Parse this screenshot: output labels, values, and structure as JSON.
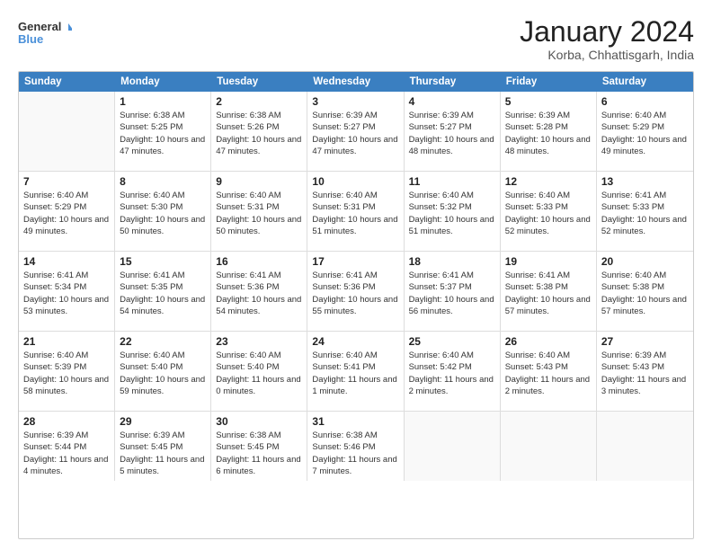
{
  "header": {
    "logo_line1": "General",
    "logo_line2": "Blue",
    "month_title": "January 2024",
    "location": "Korba, Chhattisgarh, India"
  },
  "weekdays": [
    "Sunday",
    "Monday",
    "Tuesday",
    "Wednesday",
    "Thursday",
    "Friday",
    "Saturday"
  ],
  "rows": [
    [
      {
        "day": "",
        "sunrise": "",
        "sunset": "",
        "daylight": ""
      },
      {
        "day": "1",
        "sunrise": "Sunrise: 6:38 AM",
        "sunset": "Sunset: 5:25 PM",
        "daylight": "Daylight: 10 hours and 47 minutes."
      },
      {
        "day": "2",
        "sunrise": "Sunrise: 6:38 AM",
        "sunset": "Sunset: 5:26 PM",
        "daylight": "Daylight: 10 hours and 47 minutes."
      },
      {
        "day": "3",
        "sunrise": "Sunrise: 6:39 AM",
        "sunset": "Sunset: 5:27 PM",
        "daylight": "Daylight: 10 hours and 47 minutes."
      },
      {
        "day": "4",
        "sunrise": "Sunrise: 6:39 AM",
        "sunset": "Sunset: 5:27 PM",
        "daylight": "Daylight: 10 hours and 48 minutes."
      },
      {
        "day": "5",
        "sunrise": "Sunrise: 6:39 AM",
        "sunset": "Sunset: 5:28 PM",
        "daylight": "Daylight: 10 hours and 48 minutes."
      },
      {
        "day": "6",
        "sunrise": "Sunrise: 6:40 AM",
        "sunset": "Sunset: 5:29 PM",
        "daylight": "Daylight: 10 hours and 49 minutes."
      }
    ],
    [
      {
        "day": "7",
        "sunrise": "Sunrise: 6:40 AM",
        "sunset": "Sunset: 5:29 PM",
        "daylight": "Daylight: 10 hours and 49 minutes."
      },
      {
        "day": "8",
        "sunrise": "Sunrise: 6:40 AM",
        "sunset": "Sunset: 5:30 PM",
        "daylight": "Daylight: 10 hours and 50 minutes."
      },
      {
        "day": "9",
        "sunrise": "Sunrise: 6:40 AM",
        "sunset": "Sunset: 5:31 PM",
        "daylight": "Daylight: 10 hours and 50 minutes."
      },
      {
        "day": "10",
        "sunrise": "Sunrise: 6:40 AM",
        "sunset": "Sunset: 5:31 PM",
        "daylight": "Daylight: 10 hours and 51 minutes."
      },
      {
        "day": "11",
        "sunrise": "Sunrise: 6:40 AM",
        "sunset": "Sunset: 5:32 PM",
        "daylight": "Daylight: 10 hours and 51 minutes."
      },
      {
        "day": "12",
        "sunrise": "Sunrise: 6:40 AM",
        "sunset": "Sunset: 5:33 PM",
        "daylight": "Daylight: 10 hours and 52 minutes."
      },
      {
        "day": "13",
        "sunrise": "Sunrise: 6:41 AM",
        "sunset": "Sunset: 5:33 PM",
        "daylight": "Daylight: 10 hours and 52 minutes."
      }
    ],
    [
      {
        "day": "14",
        "sunrise": "Sunrise: 6:41 AM",
        "sunset": "Sunset: 5:34 PM",
        "daylight": "Daylight: 10 hours and 53 minutes."
      },
      {
        "day": "15",
        "sunrise": "Sunrise: 6:41 AM",
        "sunset": "Sunset: 5:35 PM",
        "daylight": "Daylight: 10 hours and 54 minutes."
      },
      {
        "day": "16",
        "sunrise": "Sunrise: 6:41 AM",
        "sunset": "Sunset: 5:36 PM",
        "daylight": "Daylight: 10 hours and 54 minutes."
      },
      {
        "day": "17",
        "sunrise": "Sunrise: 6:41 AM",
        "sunset": "Sunset: 5:36 PM",
        "daylight": "Daylight: 10 hours and 55 minutes."
      },
      {
        "day": "18",
        "sunrise": "Sunrise: 6:41 AM",
        "sunset": "Sunset: 5:37 PM",
        "daylight": "Daylight: 10 hours and 56 minutes."
      },
      {
        "day": "19",
        "sunrise": "Sunrise: 6:41 AM",
        "sunset": "Sunset: 5:38 PM",
        "daylight": "Daylight: 10 hours and 57 minutes."
      },
      {
        "day": "20",
        "sunrise": "Sunrise: 6:40 AM",
        "sunset": "Sunset: 5:38 PM",
        "daylight": "Daylight: 10 hours and 57 minutes."
      }
    ],
    [
      {
        "day": "21",
        "sunrise": "Sunrise: 6:40 AM",
        "sunset": "Sunset: 5:39 PM",
        "daylight": "Daylight: 10 hours and 58 minutes."
      },
      {
        "day": "22",
        "sunrise": "Sunrise: 6:40 AM",
        "sunset": "Sunset: 5:40 PM",
        "daylight": "Daylight: 10 hours and 59 minutes."
      },
      {
        "day": "23",
        "sunrise": "Sunrise: 6:40 AM",
        "sunset": "Sunset: 5:40 PM",
        "daylight": "Daylight: 11 hours and 0 minutes."
      },
      {
        "day": "24",
        "sunrise": "Sunrise: 6:40 AM",
        "sunset": "Sunset: 5:41 PM",
        "daylight": "Daylight: 11 hours and 1 minute."
      },
      {
        "day": "25",
        "sunrise": "Sunrise: 6:40 AM",
        "sunset": "Sunset: 5:42 PM",
        "daylight": "Daylight: 11 hours and 2 minutes."
      },
      {
        "day": "26",
        "sunrise": "Sunrise: 6:40 AM",
        "sunset": "Sunset: 5:43 PM",
        "daylight": "Daylight: 11 hours and 2 minutes."
      },
      {
        "day": "27",
        "sunrise": "Sunrise: 6:39 AM",
        "sunset": "Sunset: 5:43 PM",
        "daylight": "Daylight: 11 hours and 3 minutes."
      }
    ],
    [
      {
        "day": "28",
        "sunrise": "Sunrise: 6:39 AM",
        "sunset": "Sunset: 5:44 PM",
        "daylight": "Daylight: 11 hours and 4 minutes."
      },
      {
        "day": "29",
        "sunrise": "Sunrise: 6:39 AM",
        "sunset": "Sunset: 5:45 PM",
        "daylight": "Daylight: 11 hours and 5 minutes."
      },
      {
        "day": "30",
        "sunrise": "Sunrise: 6:38 AM",
        "sunset": "Sunset: 5:45 PM",
        "daylight": "Daylight: 11 hours and 6 minutes."
      },
      {
        "day": "31",
        "sunrise": "Sunrise: 6:38 AM",
        "sunset": "Sunset: 5:46 PM",
        "daylight": "Daylight: 11 hours and 7 minutes."
      },
      {
        "day": "",
        "sunrise": "",
        "sunset": "",
        "daylight": ""
      },
      {
        "day": "",
        "sunrise": "",
        "sunset": "",
        "daylight": ""
      },
      {
        "day": "",
        "sunrise": "",
        "sunset": "",
        "daylight": ""
      }
    ]
  ]
}
